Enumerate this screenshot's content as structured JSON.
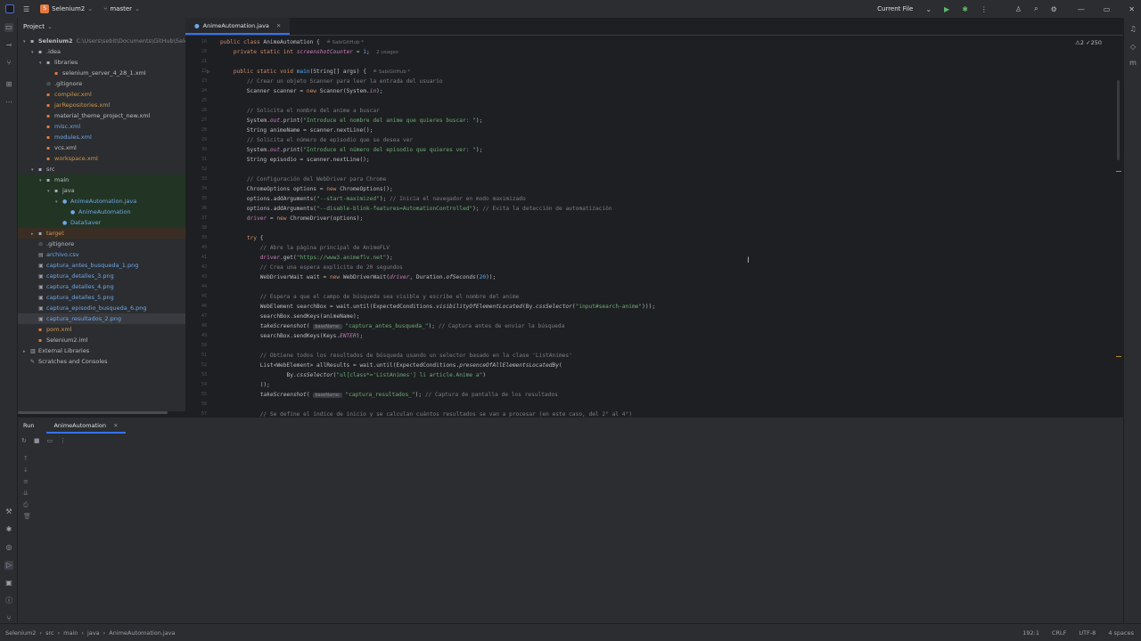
{
  "titlebar": {
    "project_badge": "S",
    "project_name": "Selenium2",
    "branch": "master",
    "run_config": "Current File"
  },
  "project_panel": {
    "title": "Project",
    "tree": [
      {
        "indent": 0,
        "arrow": "▾",
        "icon": "folder",
        "label": "Selenium2",
        "extra": "C:\\Users\\sebit\\Documents\\GitHub\\Seleni",
        "cls": "bold"
      },
      {
        "indent": 1,
        "arrow": "▾",
        "icon": "folder",
        "label": ".idea"
      },
      {
        "indent": 2,
        "arrow": "▾",
        "icon": "folder",
        "label": "libraries"
      },
      {
        "indent": 3,
        "arrow": "",
        "icon": "xml",
        "label": "selenium_server_4_28_1.xml"
      },
      {
        "indent": 2,
        "arrow": "",
        "icon": "ignore",
        "label": ".gitignore"
      },
      {
        "indent": 2,
        "arrow": "",
        "icon": "xml",
        "label": "compiler.xml",
        "cls": "ignored"
      },
      {
        "indent": 2,
        "arrow": "",
        "icon": "xml",
        "label": "jarRepositories.xml",
        "cls": "ignored"
      },
      {
        "indent": 2,
        "arrow": "",
        "icon": "xml",
        "label": "material_theme_project_new.xml"
      },
      {
        "indent": 2,
        "arrow": "",
        "icon": "xml",
        "label": "misc.xml",
        "cls": "modified"
      },
      {
        "indent": 2,
        "arrow": "",
        "icon": "xml",
        "label": "modules.xml",
        "cls": "modified"
      },
      {
        "indent": 2,
        "arrow": "",
        "icon": "xml",
        "label": "vcs.xml"
      },
      {
        "indent": 2,
        "arrow": "",
        "icon": "xml",
        "label": "workspace.xml",
        "cls": "ignored"
      },
      {
        "indent": 1,
        "arrow": "▾",
        "icon": "folder",
        "label": "src"
      },
      {
        "indent": 2,
        "arrow": "▾",
        "icon": "folder",
        "label": "main",
        "bg": "sel-green"
      },
      {
        "indent": 3,
        "arrow": "▾",
        "icon": "folder",
        "label": "java",
        "bg": "sel-green"
      },
      {
        "indent": 4,
        "arrow": "▾",
        "icon": "java",
        "label": "AnimeAutomation.java",
        "cls": "modified",
        "bg": "sel-green"
      },
      {
        "indent": 5,
        "arrow": "",
        "icon": "class",
        "label": "AnimeAutomation",
        "cls": "modified",
        "bg": "sel-green"
      },
      {
        "indent": 4,
        "arrow": "",
        "icon": "class",
        "label": "DataSaver",
        "cls": "modified",
        "bg": "sel-green"
      },
      {
        "indent": 1,
        "arrow": "▸",
        "icon": "folder",
        "label": "target",
        "cls": "ignored",
        "bg": "sel-orange"
      },
      {
        "indent": 1,
        "arrow": "",
        "icon": "ignore",
        "label": ".gitignore"
      },
      {
        "indent": 1,
        "arrow": "",
        "icon": "csv",
        "label": "archivo.csv",
        "cls": "modified"
      },
      {
        "indent": 1,
        "arrow": "",
        "icon": "png",
        "label": "captura_antes_busqueda_1.png",
        "cls": "modified"
      },
      {
        "indent": 1,
        "arrow": "",
        "icon": "png",
        "label": "captura_detalles_3.png",
        "cls": "modified"
      },
      {
        "indent": 1,
        "arrow": "",
        "icon": "png",
        "label": "captura_detalles_4.png",
        "cls": "modified"
      },
      {
        "indent": 1,
        "arrow": "",
        "icon": "png",
        "label": "captura_detalles_5.png",
        "cls": "modified"
      },
      {
        "indent": 1,
        "arrow": "",
        "icon": "png",
        "label": "captura_episodio_busqueda_6.png",
        "cls": "modified"
      },
      {
        "indent": 1,
        "arrow": "",
        "icon": "png",
        "label": "captura_resultados_2.png",
        "cls": "modified",
        "bg": "sel-gray"
      },
      {
        "indent": 1,
        "arrow": "",
        "icon": "xml",
        "label": "pom.xml",
        "cls": "ignored"
      },
      {
        "indent": 1,
        "arrow": "",
        "icon": "xml",
        "label": "Selenium2.iml"
      },
      {
        "indent": 0,
        "arrow": "▸",
        "icon": "lib",
        "label": "External Libraries"
      },
      {
        "indent": 0,
        "arrow": "",
        "icon": "scratch",
        "label": "Scratches and Consoles"
      }
    ]
  },
  "editor": {
    "tab_label": "AnimeAutomation.java",
    "inspections": "⚠2 ✓250",
    "author_hint": "≗ SabiGitHub *",
    "usages_hint": "2 usages"
  },
  "code_lines": [
    {
      "n": "16",
      "h": "<span class='kw'>public class</span> AnimeAutomation {  <span class='hint'>≗ SabiGitHub *</span>",
      "i": 0
    },
    {
      "n": "20",
      "h": "    <span class='kw'>private static int</span> <span class='fld it'>screenshotCounter</span> = <span class='fn'>1</span>;  <span class='hint'>2 usages</span>",
      "i": 0
    },
    {
      "n": "21",
      "h": "",
      "i": 0
    },
    {
      "n": "22",
      "h": "    <span class='kw'>public static void</span> <span class='fn'>main</span>(String[] args) {  <span class='hint'>≗ SabiGitHub *</span>",
      "i": 0,
      "run": true
    },
    {
      "n": "23",
      "h": "        <span class='cm'>// Crear un objeto Scanner para leer la entrada del usuario</span>",
      "i": 0
    },
    {
      "n": "24",
      "h": "        Scanner scanner = <span class='kw'>new</span> Scanner(System.<span class='fld it'>in</span>);",
      "i": 0
    },
    {
      "n": "25",
      "h": "",
      "i": 0
    },
    {
      "n": "26",
      "h": "        <span class='cm'>// Solicita el nombre del anime a buscar</span>",
      "i": 0
    },
    {
      "n": "27",
      "h": "        System.<span class='fld it'>out</span>.print(<span class='st'>\"Introduce el nombre del anime que quieres buscar: \"</span>);",
      "i": 0
    },
    {
      "n": "28",
      "h": "        String animeName = scanner.nextLine();",
      "i": 0
    },
    {
      "n": "29",
      "h": "        <span class='cm'>// Solicita el número de episodio que se desea ver</span>",
      "i": 0
    },
    {
      "n": "30",
      "h": "        System.<span class='fld it'>out</span>.print(<span class='st'>\"Introduce el número del episodio que quieres ver: \"</span>);",
      "i": 0
    },
    {
      "n": "31",
      "h": "        String episodio = scanner.nextLine();",
      "i": 0
    },
    {
      "n": "32",
      "h": "",
      "i": 0
    },
    {
      "n": "33",
      "h": "        <span class='cm'>// Configuración del WebDriver para Chrome</span>",
      "i": 0
    },
    {
      "n": "34",
      "h": "        ChromeOptions options = <span class='kw'>new</span> ChromeOptions();",
      "i": 0
    },
    {
      "n": "35",
      "h": "        options.addArguments(<span class='st'>\"--start-maximized\"</span>); <span class='cm'>// Inicia el navegador en modo maximizado</span>",
      "i": 0
    },
    {
      "n": "36",
      "h": "        options.addArguments(<span class='st'>\"--disable-blink-features=AutomationControlled\"</span>); <span class='cm'>// Evita la detección de automatización</span>",
      "i": 0
    },
    {
      "n": "37",
      "h": "        <span class='fld'>driver</span> = <span class='kw'>new</span> ChromeDriver(options);",
      "i": 0
    },
    {
      "n": "38",
      "h": "",
      "i": 0
    },
    {
      "n": "39",
      "h": "        <span class='kw'>try</span> {",
      "i": 0
    },
    {
      "n": "40",
      "h": "            <span class='cm'>// Abre la página principal de AnimeFLV</span>",
      "i": 0
    },
    {
      "n": "41",
      "h": "            <span class='fld'>driver</span>.get(<span class='st'>\"https://www3.animeflv.net\"</span>);",
      "i": 0
    },
    {
      "n": "42",
      "h": "            <span class='cm'>// Crea una espera explícita de 20 segundos</span>",
      "i": 0
    },
    {
      "n": "43",
      "h": "            WebDriverWait wait = <span class='kw'>new</span> WebDriverWait(<span class='fld it'>driver</span>, Duration.<span class='it'>ofSeconds</span>(<span class='fn'>20</span>));",
      "i": 0
    },
    {
      "n": "44",
      "h": "",
      "i": 0
    },
    {
      "n": "45",
      "h": "            <span class='cm'>// Espera a que el campo de búsqueda sea visible y escribe el nombre del anime</span>",
      "i": 0
    },
    {
      "n": "46",
      "h": "            WebElement searchBox = wait.until(ExpectedConditions.<span class='it'>visibilityOfElementLocated</span>(By.<span class='it'>cssSelector</span>(<span class='st'>\"input#search-anime\"</span>)));",
      "i": 0
    },
    {
      "n": "47",
      "h": "            searchBox.sendKeys(animeName);",
      "i": 0
    },
    {
      "n": "48",
      "h": "            <span class='it'>takeScreenshot</span>( <span class='pill'>baseName:</span> <span class='st'>\"captura_antes_busqueda_\"</span>); <span class='cm'>// Captura antes de enviar la búsqueda</span>",
      "i": 0
    },
    {
      "n": "49",
      "h": "            searchBox.sendKeys(Keys.<span class='fld it'>ENTER</span>);",
      "i": 0
    },
    {
      "n": "50",
      "h": "",
      "i": 0
    },
    {
      "n": "51",
      "h": "            <span class='cm'>// Obtiene todos los resultados de búsqueda usando un selector basado en la clase 'ListAnimes'</span>",
      "i": 0
    },
    {
      "n": "52",
      "h": "            List&lt;WebElement&gt; allResults = wait.until(ExpectedConditions.<span class='it'>presenceOfAllElementsLocatedBy</span>(",
      "i": 0
    },
    {
      "n": "53",
      "h": "                    By.<span class='it'>cssSelector</span>(<span class='st'>\"ul[class*='ListAnimes'] li article.Anime a\"</span>)",
      "i": 0
    },
    {
      "n": "54",
      "h": "            ));",
      "i": 0
    },
    {
      "n": "55",
      "h": "            <span class='it'>takeScreenshot</span>( <span class='pill'>baseName:</span> <span class='st'>\"captura_resultados_\"</span>); <span class='cm'>// Captura de pantalla de los resultados</span>",
      "i": 0
    },
    {
      "n": "56",
      "h": "",
      "i": 0
    },
    {
      "n": "57",
      "h": "            <span class='cm'>// Se define el índice de inicio y se calculan cuántos resultados se van a procesar (en este caso, del 2° al 4°)</span>",
      "i": 0
    }
  ],
  "run_panel": {
    "label": "Run",
    "tab": "AnimeAutomation"
  },
  "status_bar": {
    "crumbs": [
      "Selenium2",
      "src",
      "main",
      "java",
      "AnimeAutomation.java"
    ],
    "position": "192:1",
    "line_sep": "CRLF",
    "encoding": "UTF-8",
    "indent": "4 spaces"
  }
}
